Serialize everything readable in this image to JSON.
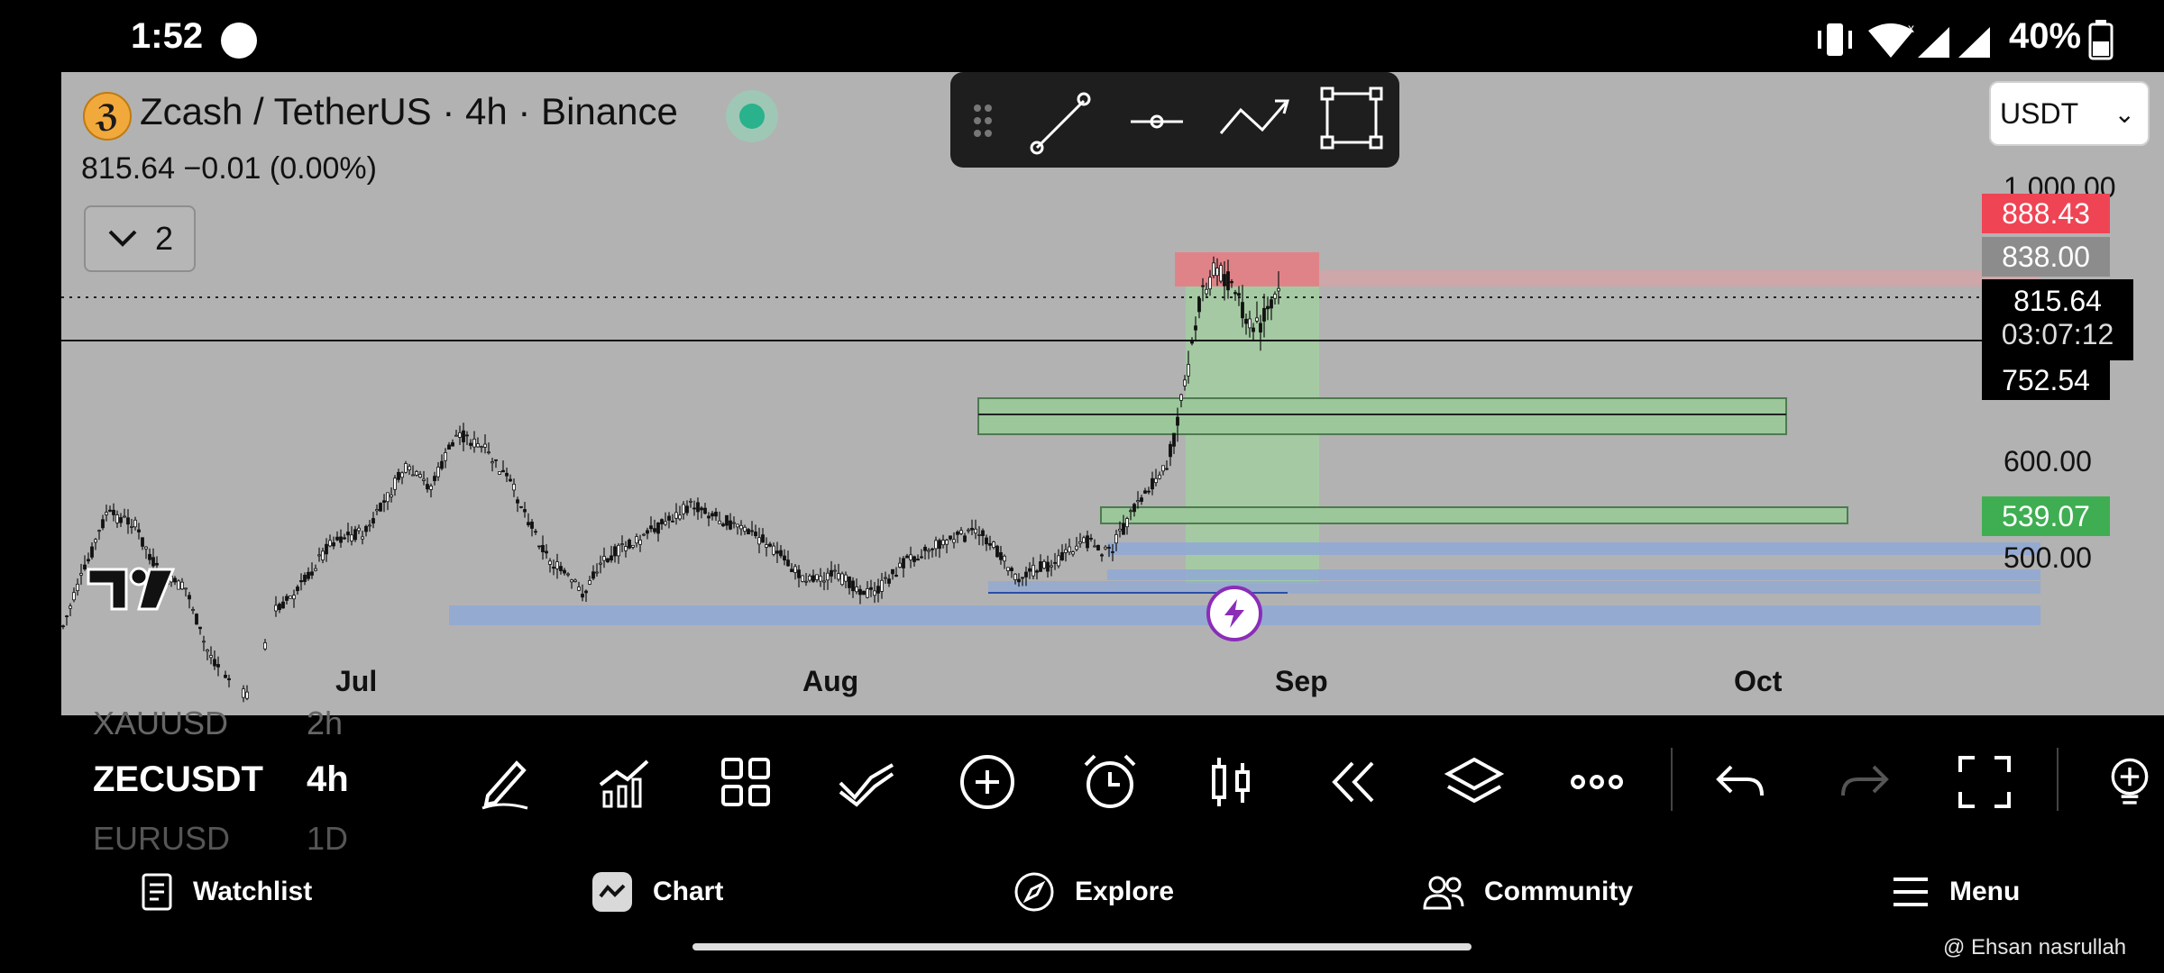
{
  "status_bar": {
    "time": "1:52",
    "battery_percent": "40%"
  },
  "chart": {
    "symbol_title": "Zcash / TetherUS · 4h · Binance",
    "price_readout": "815.64  −0.01 (0.00%)",
    "indicator_count": "2",
    "currency": "USDT",
    "price_axis": [
      "1,000.00",
      "600.00",
      "500.00"
    ],
    "price_tags": {
      "sl": "888.43",
      "high": "838.00",
      "last": "815.64",
      "countdown": "03:07:12",
      "crosshair": "752.54",
      "support": "539.07"
    },
    "months": [
      "Jul",
      "Aug",
      "Sep",
      "Oct"
    ],
    "colors": {
      "up_tag": "#3fae52",
      "down_tag": "#ef4454",
      "gray_tag": "#8c8c8c",
      "panel_bg": "#b2b2b2"
    }
  },
  "bottom_toolbar": {
    "symbol_prev": "XAUUSD",
    "symbol_current": "ZECUSDT",
    "symbol_next": "EURUSD",
    "interval_prev": "2h",
    "interval_current": "4h",
    "interval_next": "1D",
    "icons": [
      "pencil-icon",
      "indicators-icon",
      "layouts-icon",
      "compare-icon",
      "plus-circle-icon",
      "alarm-icon",
      "candles-icon",
      "replay-icon",
      "layers-icon",
      "more-icon",
      "undo-icon",
      "redo-icon",
      "fullscreen-icon",
      "bulb-icon"
    ]
  },
  "nav": {
    "watchlist": "Watchlist",
    "chart": "Chart",
    "explore": "Explore",
    "community": "Community",
    "menu": "Menu"
  },
  "watermark": "@ Ehsan nasrullah"
}
